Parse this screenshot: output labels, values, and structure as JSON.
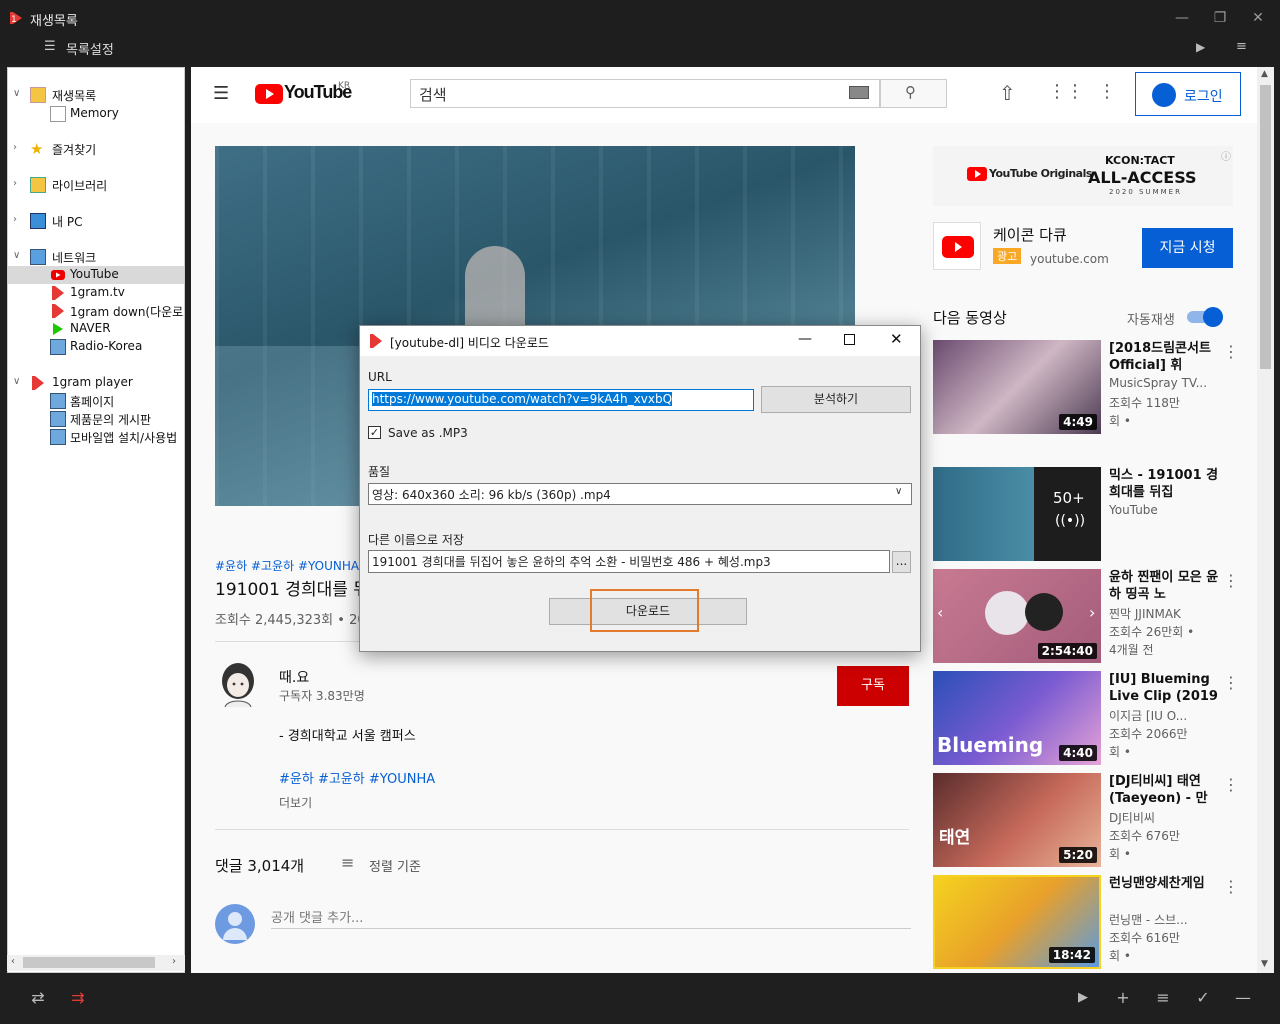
{
  "window": {
    "title": "재생목록"
  },
  "toolbar": {
    "list_settings": "목록설정"
  },
  "sidebar": {
    "items": [
      {
        "label": "재생목록"
      },
      {
        "label": "Memory"
      },
      {
        "label": "즐겨찾기"
      },
      {
        "label": "라이브러리"
      },
      {
        "label": "내 PC"
      },
      {
        "label": "네트워크"
      },
      {
        "label": "YouTube"
      },
      {
        "label": "1gram.tv"
      },
      {
        "label": "1gram down(다운로드"
      },
      {
        "label": "NAVER"
      },
      {
        "label": "Radio-Korea"
      },
      {
        "label": "1gram player"
      },
      {
        "label": "홈페이지"
      },
      {
        "label": "제품문의 게시판"
      },
      {
        "label": "모바일앱 설치/사용법"
      }
    ]
  },
  "youtube": {
    "logo_text": "YouTube",
    "region": "KR",
    "search_placeholder": "검색",
    "login": "로그인",
    "video": {
      "hashtags": "#윤하 #고윤하 #YOUNHA",
      "title": "191001 경희대를 뒤",
      "views": "조회수 2,445,323회 • 20"
    },
    "channel": {
      "name": "때.요",
      "subscribers": "구독자 3.83만명",
      "subscribe": "구독",
      "desc": "- 경희대학교 서울 캠퍼스",
      "tags": "#윤하 #고윤하 #YOUNHA",
      "more": "더보기"
    },
    "comments": {
      "count": "댓글 3,014개",
      "sort": "정렬 기준",
      "add": "공개 댓글 추가..."
    },
    "ad": {
      "originals": "YouTube Originals",
      "kcon": "KCON:TACT",
      "access": "ALL-ACCESS",
      "season": "2020 SUMMER",
      "name": "케이콘 다큐",
      "badge": "광고",
      "url": "youtube.com",
      "cta": "지금 시청"
    },
    "upnext": {
      "label": "다음 동영상",
      "autoplay": "자동재생"
    },
    "recs": [
      {
        "title": "[2018드림콘서트 Official] 휘",
        "channel": "MusicSpray TV...",
        "views": "조회수 118만",
        "views2": "회 •",
        "duration": "4:49"
      },
      {
        "title": "믹스 - 191001 경희대를 뒤집",
        "channel": "YouTube",
        "views": "",
        "views2": "",
        "duration": "50+"
      },
      {
        "title": "윤하 찐팬이 모은 윤하 띵곡 노",
        "channel": "찐막 JJINMAK",
        "views": "조회수 26만회 •",
        "views2": "4개월 전",
        "duration": "2:54:40"
      },
      {
        "title": "[IU] Blueming Live Clip (2019",
        "channel": "이지금 [IU O...",
        "views": "조회수 2066만",
        "views2": "회 •",
        "duration": "4:40"
      },
      {
        "title": "[DJ티비씨] 태연(Taeyeon) - 만",
        "channel": "DJ티비씨",
        "views": "조회수 676만",
        "views2": "회 •",
        "duration": "5:20"
      },
      {
        "title": "런닝맨양세찬게임",
        "channel": "런닝맨 - 스브...",
        "views": "조회수 616만",
        "views2": "회 •",
        "duration": "18:42"
      }
    ]
  },
  "dialog": {
    "title": "[youtube-dl]  비디오 다운로드",
    "url_label": "URL",
    "url_value": "https://www.youtube.com/watch?v=9kA4h_xvxbQ",
    "analyze": "분석하기",
    "save_mp3": "Save as .MP3",
    "quality_label": "품질",
    "quality_value": "영상: 640x360 소리:  96 kb/s (360p) .mp4",
    "saveas_label": "다른 이름으로 저장",
    "filename": "191001 경희대를 뒤집어 놓은 윤하의 추억 소환 - 비밀번호 486 + 혜성.mp3",
    "browse": "...",
    "download": "다운로드"
  }
}
